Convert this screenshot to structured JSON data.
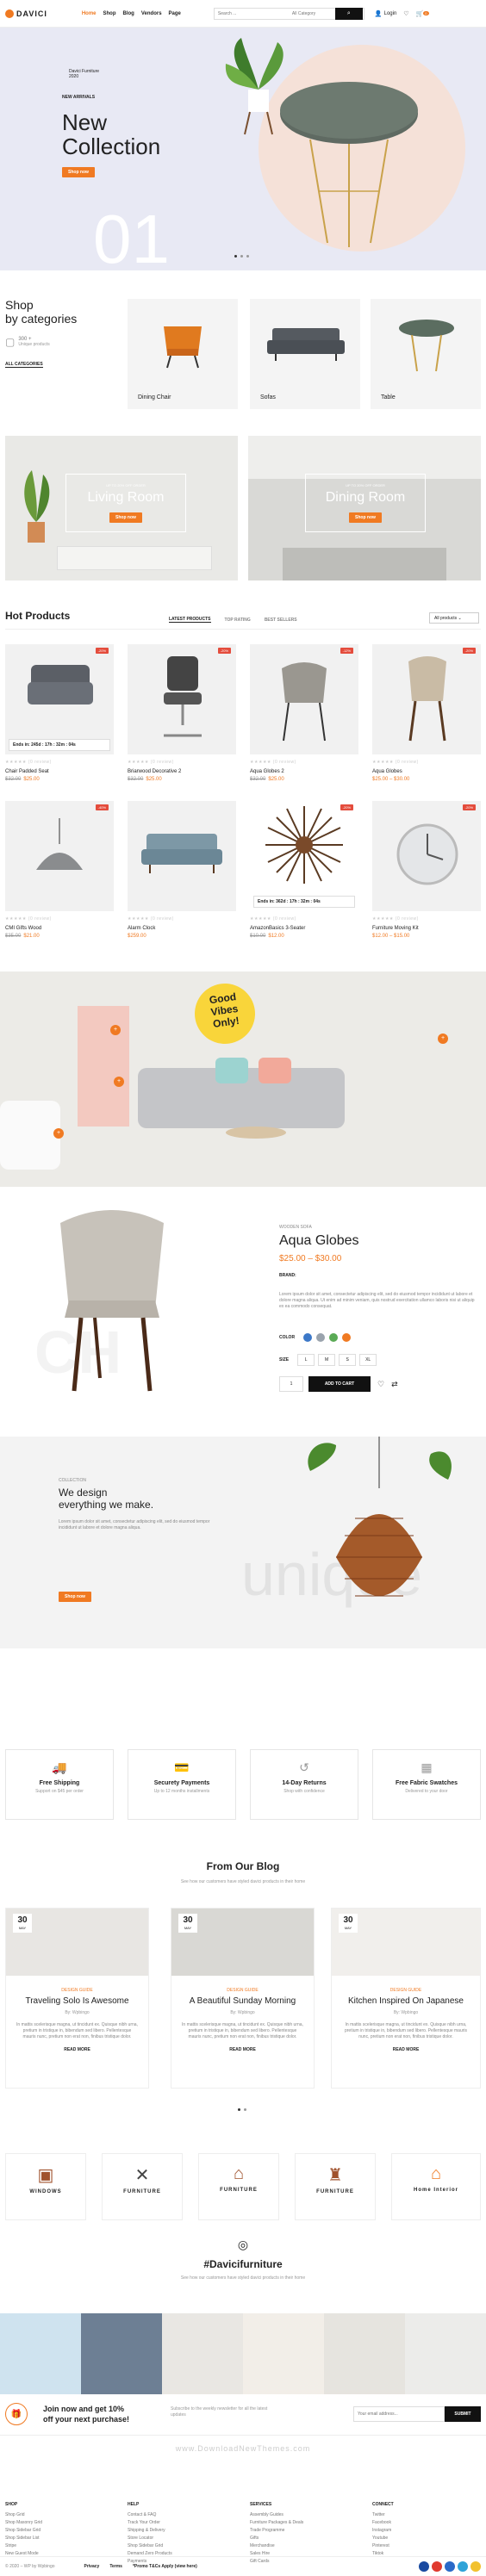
{
  "header": {
    "logo": "DAVICI",
    "nav": [
      "Home",
      "Shop",
      "Blog",
      "Vendors",
      "Page"
    ],
    "search_placeholder": "Search ...",
    "category": "All Category",
    "login": "Login",
    "cart_count": "0"
  },
  "hero": {
    "kicker": "Davici Furniture 2020",
    "label": "NEW ARRIVALS",
    "title": "New Collection",
    "button": "Shop now",
    "number": "01"
  },
  "categories": {
    "heading_1": "Shop",
    "heading_2": "by categories",
    "count": "300 +",
    "count_sub": "Unique products",
    "all_link": "ALL CATEGORIES",
    "items": [
      "Dining Chair",
      "Sofas",
      "Table"
    ]
  },
  "banners": [
    {
      "small": "UP TO 20% OFF ORDER",
      "title": "Living Room",
      "button": "Shop now"
    },
    {
      "small": "UP TO 20% OFF ORDER",
      "title": "Dining Room",
      "button": "Shop now"
    }
  ],
  "hot": {
    "heading": "Hot Products",
    "tabs": [
      "LATEST PRODUCTS",
      "TOP RATING",
      "BEST SELLERS"
    ],
    "select": "All products",
    "products": [
      {
        "name": "Chair Padded Seat",
        "old": "$32.00",
        "price": "$25.00",
        "badge": "-20%",
        "timer": "Ends in: 245d : 17h : 32m : 04s"
      },
      {
        "name": "Briarwood Decorative 2",
        "old": "$32.00",
        "price": "$25.00",
        "badge": "-20%",
        "timer": ""
      },
      {
        "name": "Aqua Globes 2",
        "old": "$32.00",
        "price": "$25.00",
        "badge": "-12%",
        "timer": ""
      },
      {
        "name": "Aqua Globes",
        "old": "",
        "price": "$25.00 – $30.00",
        "badge": "-20%",
        "timer": ""
      },
      {
        "name": "CMI Gifts Wood",
        "old": "$35.00",
        "price": "$21.00",
        "badge": "-40%",
        "timer": ""
      },
      {
        "name": "Alarm Clock",
        "old": "",
        "price": "$259.00",
        "badge": "",
        "timer": ""
      },
      {
        "name": "AmazonBasics 3-Seater",
        "old": "$10.00",
        "price": "$12.00",
        "badge": "-20%",
        "timer": "Ends in: 362d : 17h : 32m : 04s"
      },
      {
        "name": "Furniture Moving Kit",
        "old": "",
        "price": "$12.00 – $15.00",
        "badge": "-20%",
        "timer": ""
      }
    ],
    "stars": "★★★★★ (0 review)"
  },
  "lifestyle": {
    "sign_1": "Good",
    "sign_2": "Vibes",
    "sign_3": "Only!"
  },
  "featured": {
    "label": "WOODEN SOFA",
    "title": "Aqua Globes",
    "price": "$25.00 – $30.00",
    "brand_label": "BRAND:",
    "desc": "Lorem ipsum dolor sit amet, consectetur adipiscing elit, sed do eiusmod tempor incididunt ut labore et dolore magna aliqua. Ut enim ad minim veniam, quis nostrud exercitation ullamco laboris nisi ut aliquip ex ea commodo consequat.",
    "color_label": "COLOR",
    "size_label": "SIZE",
    "sizes": [
      "L",
      "M",
      "S",
      "XL"
    ],
    "qty": "1",
    "add": "ADD TO CART",
    "colors": [
      "#3c78c8",
      "#9aa3ad",
      "#5aaa55",
      "#f07a22"
    ]
  },
  "design": {
    "small": "COLLECTION",
    "title_1": "We design",
    "title_2": "everything we make.",
    "desc": "Lorem ipsum dolor sit amet, consectetur adipiscing elit, sed do eiusmod tempor incididunt ut labore et dolore magna aliqua.",
    "button": "Shop now",
    "ghost": "unique"
  },
  "features": [
    {
      "t": "Free Shipping",
      "s": "Support on $45 per order"
    },
    {
      "t": "Securety Payments",
      "s": "Up to 12 months installments"
    },
    {
      "t": "14-Day Returns",
      "s": "Shop with confidence"
    },
    {
      "t": "Free Fabric Swatches",
      "s": "Delivered to your door"
    }
  ],
  "blog": {
    "heading": "From Our Blog",
    "sub": "See how our customers have styled davici products in their home",
    "posts": [
      {
        "day": "30",
        "mon": "MAY",
        "cat": "DESIGN GUIDE",
        "title": "Traveling Solo Is Awesome",
        "by": "By: Wpbingo"
      },
      {
        "day": "30",
        "mon": "MAY",
        "cat": "DESIGN GUIDE",
        "title": "A Beautiful Sunday Morning",
        "by": "By: Wpbingo"
      },
      {
        "day": "30",
        "mon": "MAY",
        "cat": "DESIGN GUIDE",
        "title": "Kitchen Inspired On Japanese",
        "by": "By: Wpbingo"
      }
    ],
    "excerpt": "In mattis scelerisque magna, ut tincidunt ex. Quisque nibh urna, pretium in tristique in, bibendum sed libero. Pellentesque mauris nunc, pretium non erat non, finibus tristique dolor.",
    "more": "READ MORE"
  },
  "brands": [
    "WINDOWS",
    "FURNITURE",
    "FURNITURE",
    "FURNITURE",
    "Home Interior"
  ],
  "insta": {
    "icon": "◎",
    "title": "#Davicifurniture",
    "sub": "See how our customers have styled davici products in their home"
  },
  "newsletter": {
    "line1": "Join now and get 10%",
    "line2": "off your next purchase!",
    "desc": "Subscribe to the weekly newsletter for all the latest updates",
    "placeholder": "Your email address...",
    "button": "SUBMIT"
  },
  "watermark": "www.DownloadNewThemes.com",
  "footer": {
    "cols": [
      {
        "h": "SHOP",
        "l": [
          "Shop Grid",
          "Shop Masonry Grid",
          "Shop Sidebar Grid",
          "Shop Sidebar List",
          "Stripe",
          "New Guest Mode"
        ]
      },
      {
        "h": "HELP",
        "l": [
          "Contact & FAQ",
          "Track Your Order",
          "Shipping & Delivery",
          "Store Locator",
          "Shop Sidebar Grid",
          "Demand Zero Products",
          "Payments"
        ]
      },
      {
        "h": "SERVICES",
        "l": [
          "Assembly Guides",
          "Furniture Packages & Deals",
          "Trade Programme",
          "Gifts",
          "Merchandise",
          "Sales Hire",
          "Gift Cards"
        ]
      },
      {
        "h": "CONNECT",
        "l": [
          "Twitter",
          "Facebook",
          "Instagram",
          "Youtube",
          "Pinterest",
          "Tiktok"
        ]
      }
    ],
    "copy": "© 2020 – WP by Wpbingo",
    "links": [
      "Privacy",
      "Terms",
      "*Promo T&Cs Apply (view here)"
    ]
  }
}
